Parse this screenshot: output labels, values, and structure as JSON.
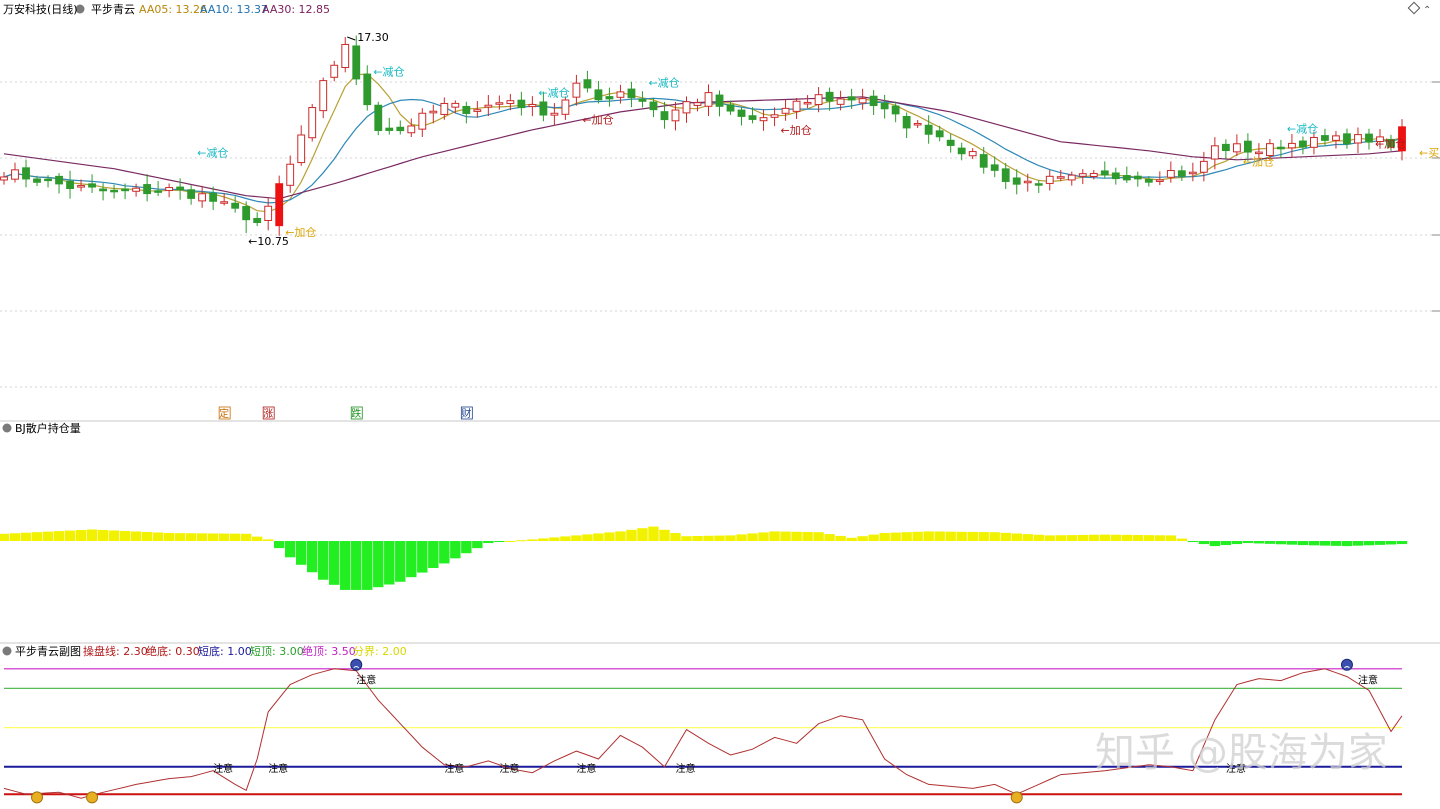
{
  "main_panel": {
    "stock_title": "万安科技(日线)",
    "indicator": "平步青云",
    "ma_readouts": [
      {
        "label": "AA05: 13.26",
        "color": "#b8860b"
      },
      {
        "label": "AA10: 13.37",
        "color": "#1e6fb0"
      },
      {
        "label": "AA30: 12.85",
        "color": "#7a1f5c"
      }
    ],
    "high_label": "17.30",
    "low_label": "←10.75",
    "signals": [
      {
        "text": "←减仓",
        "bar": 17,
        "price": 13.45,
        "color": "#16b8c4"
      },
      {
        "text": "←加仓",
        "bar": 25,
        "price": 10.78,
        "color": "#d9a400"
      },
      {
        "text": "←减仓",
        "bar": 33,
        "price": 16.15,
        "color": "#16b8c4"
      },
      {
        "text": "←减仓",
        "bar": 48,
        "price": 15.45,
        "color": "#16b8c4"
      },
      {
        "text": "←加仓",
        "bar": 52,
        "price": 14.55,
        "color": "#b01818"
      },
      {
        "text": "←减仓",
        "bar": 58,
        "price": 15.78,
        "color": "#16b8c4"
      },
      {
        "text": "←加仓",
        "bar": 70,
        "price": 14.2,
        "color": "#b01818"
      },
      {
        "text": "←加仓",
        "bar": 112,
        "price": 13.15,
        "color": "#d9a400"
      },
      {
        "text": "←减仓",
        "bar": 116,
        "price": 14.25,
        "color": "#16b8c4"
      },
      {
        "text": "←加仓",
        "bar": 124,
        "price": 13.75,
        "color": "#b01818"
      },
      {
        "text": "←买入",
        "bar": 128,
        "price": 13.45,
        "color": "#d9a400"
      }
    ],
    "event_badges": [
      {
        "text": "定",
        "bar": 20,
        "color": "#c96a00"
      },
      {
        "text": "涨",
        "bar": 24,
        "color": "#b01818"
      },
      {
        "text": "跌",
        "bar": 32,
        "color": "#1e8f1e"
      },
      {
        "text": "财",
        "bar": 42,
        "color": "#1e3f8f"
      }
    ]
  },
  "volume_panel": {
    "title": "BJ散户持仓量"
  },
  "osc_panel": {
    "title": "平步青云副图",
    "params": [
      {
        "label": "操盘线: 2.30",
        "color": "#b01818"
      },
      {
        "label": "绝底: 0.30",
        "color": "#b01818"
      },
      {
        "label": "短底: 1.00",
        "color": "#1a1a9a"
      },
      {
        "label": "短顶: 3.00",
        "color": "#2aa02a"
      },
      {
        "label": "绝顶: 3.50",
        "color": "#c020c0"
      },
      {
        "label": "分界: 2.00",
        "color": "#d8d800"
      }
    ],
    "notes": [
      {
        "text": "注意",
        "bar": 33,
        "value": 3.25
      },
      {
        "text": "注意",
        "bar": 20,
        "value": 1.0
      },
      {
        "text": "注意",
        "bar": 25,
        "value": 1.0
      },
      {
        "text": "注意",
        "bar": 41,
        "value": 1.0
      },
      {
        "text": "注意",
        "bar": 46,
        "value": 1.0
      },
      {
        "text": "注意",
        "bar": 53,
        "value": 1.0
      },
      {
        "text": "注意",
        "bar": 62,
        "value": 1.0
      },
      {
        "text": "注意",
        "bar": 124,
        "value": 3.25
      },
      {
        "text": "注意",
        "bar": 112,
        "value": 1.0
      }
    ],
    "faces": [
      {
        "bar": 32,
        "value": 3.5,
        "kind": "sad"
      },
      {
        "bar": 122,
        "value": 3.5,
        "kind": "sad"
      },
      {
        "bar": 3,
        "value": 0.27,
        "kind": "smile"
      },
      {
        "bar": 8,
        "value": 0.27,
        "kind": "smile"
      },
      {
        "bar": 92,
        "value": 0.27,
        "kind": "smile"
      }
    ]
  },
  "watermark": "知乎 @股海为家",
  "colors": {
    "up": "#cc2a2a",
    "down": "#2e9a2e",
    "ma5": "#b8a032",
    "ma10": "#2e88b8",
    "ma30": "#7a2a62",
    "vol_pos": "#f2f200",
    "vol_neg": "#22ee22",
    "osc_line": "#b03030"
  },
  "chart_data": {
    "type": "candlestick",
    "y_range": [
      8.25,
      17.6
    ],
    "ohlc_anchors": [
      [
        0,
        12.8
      ],
      [
        6,
        12.3
      ],
      [
        10,
        12.1
      ],
      [
        15,
        12.2
      ],
      [
        18,
        12.0
      ],
      [
        22,
        11.3
      ],
      [
        23,
        11.1
      ],
      [
        24,
        11.5
      ],
      [
        25,
        12.4
      ],
      [
        26,
        13.0
      ],
      [
        27,
        14.0
      ],
      [
        28,
        14.8
      ],
      [
        29,
        15.7
      ],
      [
        30,
        16.4
      ],
      [
        31,
        17.0
      ],
      [
        32,
        15.9
      ],
      [
        33,
        15.1
      ],
      [
        34,
        14.3
      ],
      [
        36,
        14.2
      ],
      [
        38,
        14.6
      ],
      [
        40,
        15.0
      ],
      [
        42,
        14.9
      ],
      [
        44,
        15.0
      ],
      [
        46,
        15.2
      ],
      [
        48,
        14.9
      ],
      [
        50,
        14.8
      ],
      [
        52,
        15.7
      ],
      [
        54,
        15.2
      ],
      [
        56,
        15.5
      ],
      [
        58,
        15.2
      ],
      [
        60,
        14.6
      ],
      [
        62,
        15.1
      ],
      [
        64,
        15.3
      ],
      [
        66,
        14.7
      ],
      [
        68,
        14.5
      ],
      [
        70,
        14.7
      ],
      [
        72,
        15.0
      ],
      [
        74,
        15.3
      ],
      [
        76,
        15.2
      ],
      [
        78,
        15.3
      ],
      [
        80,
        14.8
      ],
      [
        82,
        14.4
      ],
      [
        84,
        14.2
      ],
      [
        86,
        13.8
      ],
      [
        88,
        13.3
      ],
      [
        90,
        12.8
      ],
      [
        92,
        12.4
      ],
      [
        94,
        12.5
      ],
      [
        96,
        12.5
      ],
      [
        98,
        12.6
      ],
      [
        100,
        12.6
      ],
      [
        102,
        12.7
      ],
      [
        104,
        12.6
      ],
      [
        106,
        12.8
      ],
      [
        108,
        12.7
      ],
      [
        110,
        13.6
      ],
      [
        112,
        13.6
      ],
      [
        114,
        13.5
      ],
      [
        116,
        13.7
      ],
      [
        118,
        13.8
      ],
      [
        120,
        13.8
      ],
      [
        122,
        13.9
      ],
      [
        124,
        13.9
      ],
      [
        125,
        13.8
      ],
      [
        126,
        13.6
      ],
      [
        127,
        14.3
      ]
    ],
    "ma30_anchors": [
      [
        0,
        13.4
      ],
      [
        10,
        12.9
      ],
      [
        22,
        12.0
      ],
      [
        25,
        11.9
      ],
      [
        30,
        12.4
      ],
      [
        38,
        13.3
      ],
      [
        48,
        14.2
      ],
      [
        56,
        14.8
      ],
      [
        62,
        15.1
      ],
      [
        70,
        15.2
      ],
      [
        78,
        15.3
      ],
      [
        86,
        14.8
      ],
      [
        96,
        13.8
      ],
      [
        104,
        13.5
      ],
      [
        108,
        13.3
      ],
      [
        112,
        13.2
      ],
      [
        118,
        13.3
      ],
      [
        124,
        13.4
      ],
      [
        127,
        13.5
      ]
    ],
    "high": 17.3,
    "low": 10.75,
    "bar_count": 128,
    "volume_anchors": [
      [
        0,
        0.45
      ],
      [
        8,
        0.72
      ],
      [
        15,
        0.5
      ],
      [
        22,
        0.45
      ],
      [
        24,
        0.1
      ],
      [
        26,
        -0.8
      ],
      [
        29,
        -1.9
      ],
      [
        31,
        -2.4
      ],
      [
        33,
        -2.4
      ],
      [
        36,
        -2.0
      ],
      [
        40,
        -1.1
      ],
      [
        44,
        -0.1
      ],
      [
        48,
        0.1
      ],
      [
        52,
        0.35
      ],
      [
        56,
        0.6
      ],
      [
        59,
        0.9
      ],
      [
        62,
        0.3
      ],
      [
        66,
        0.35
      ],
      [
        70,
        0.6
      ],
      [
        74,
        0.55
      ],
      [
        77,
        0.2
      ],
      [
        80,
        0.5
      ],
      [
        84,
        0.6
      ],
      [
        90,
        0.55
      ],
      [
        95,
        0.35
      ],
      [
        100,
        0.4
      ],
      [
        106,
        0.35
      ],
      [
        108,
        -0.05
      ],
      [
        110,
        -0.25
      ],
      [
        113,
        -0.1
      ],
      [
        118,
        -0.2
      ],
      [
        122,
        -0.25
      ],
      [
        127,
        -0.15
      ]
    ],
    "volume_range": [
      -2.6,
      1.0
    ],
    "osc_anchors": [
      [
        0,
        0.45
      ],
      [
        2,
        0.3
      ],
      [
        5,
        0.35
      ],
      [
        7,
        0.2
      ],
      [
        9,
        0.35
      ],
      [
        12,
        0.55
      ],
      [
        15,
        0.7
      ],
      [
        17,
        0.75
      ],
      [
        19,
        0.9
      ],
      [
        21,
        0.55
      ],
      [
        22,
        0.4
      ],
      [
        23,
        1.2
      ],
      [
        24,
        2.4
      ],
      [
        26,
        3.1
      ],
      [
        28,
        3.35
      ],
      [
        30,
        3.5
      ],
      [
        32,
        3.45
      ],
      [
        34,
        2.7
      ],
      [
        36,
        2.1
      ],
      [
        38,
        1.5
      ],
      [
        40,
        1.05
      ],
      [
        42,
        1.0
      ],
      [
        44,
        1.15
      ],
      [
        46,
        0.95
      ],
      [
        48,
        0.85
      ],
      [
        50,
        1.15
      ],
      [
        52,
        1.4
      ],
      [
        54,
        1.2
      ],
      [
        56,
        1.8
      ],
      [
        58,
        1.5
      ],
      [
        60,
        1.0
      ],
      [
        62,
        1.95
      ],
      [
        64,
        1.6
      ],
      [
        66,
        1.3
      ],
      [
        68,
        1.45
      ],
      [
        70,
        1.75
      ],
      [
        72,
        1.6
      ],
      [
        74,
        2.1
      ],
      [
        76,
        2.3
      ],
      [
        78,
        2.2
      ],
      [
        80,
        1.2
      ],
      [
        82,
        0.8
      ],
      [
        84,
        0.55
      ],
      [
        86,
        0.5
      ],
      [
        88,
        0.45
      ],
      [
        90,
        0.55
      ],
      [
        92,
        0.3
      ],
      [
        96,
        0.8
      ],
      [
        100,
        0.9
      ],
      [
        104,
        1.05
      ],
      [
        106,
        1.0
      ],
      [
        108,
        0.9
      ],
      [
        110,
        2.2
      ],
      [
        112,
        3.1
      ],
      [
        114,
        3.25
      ],
      [
        116,
        3.2
      ],
      [
        118,
        3.4
      ],
      [
        120,
        3.5
      ],
      [
        122,
        3.3
      ],
      [
        124,
        2.95
      ],
      [
        126,
        1.9
      ],
      [
        127,
        2.3
      ]
    ],
    "osc_range": [
      0,
      3.75
    ],
    "osc_levels": [
      0.3,
      1.0,
      2.0,
      3.0,
      3.5
    ]
  }
}
